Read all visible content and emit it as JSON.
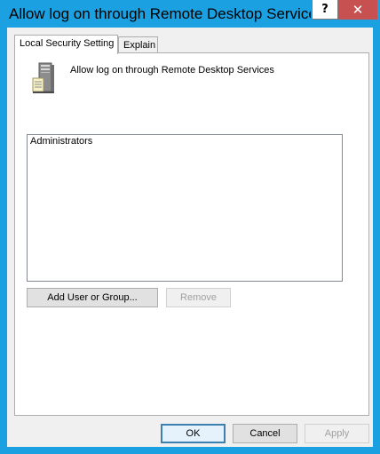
{
  "window": {
    "title": "Allow log on through Remote Desktop Services Pr...",
    "help_label": "?",
    "close_label": "✕"
  },
  "tabs": [
    {
      "label": "Local Security Setting",
      "active": true
    },
    {
      "label": "Explain",
      "active": false
    }
  ],
  "policy": {
    "icon": "server-icon",
    "name": "Allow log on through Remote Desktop Services"
  },
  "members": [
    "Administrators"
  ],
  "buttons": {
    "add": "Add User or Group...",
    "remove": "Remove",
    "ok": "OK",
    "cancel": "Cancel",
    "apply": "Apply"
  },
  "colors": {
    "frame": "#1ba1e2",
    "close": "#c75050"
  }
}
